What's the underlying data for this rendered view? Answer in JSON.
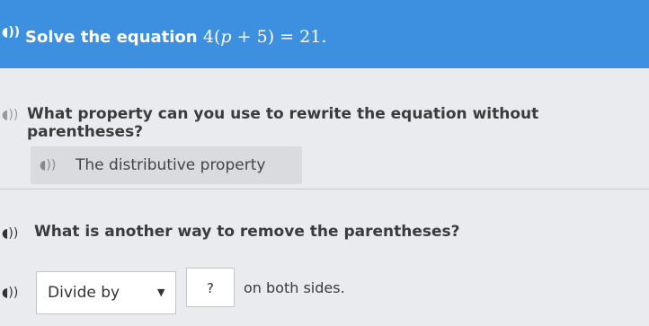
{
  "banner": {
    "prompt": "Solve the equation",
    "equation": {
      "coef": "4",
      "var": "p",
      "plus": "+",
      "const": "5",
      "rhs": "21",
      "end": "."
    }
  },
  "q1": {
    "text": "What property can you use to rewrite the equation without parentheses?"
  },
  "answer1": {
    "text": "The distributive property"
  },
  "q2": {
    "text": "What is another way to remove the parentheses?"
  },
  "row": {
    "dropdown_value": "Divide by",
    "blank_value": "?",
    "suffix": "on both sides."
  },
  "icons": {
    "audio": "speaker-icon",
    "caret": "chevron-down-icon"
  },
  "colors": {
    "banner": "#3d8fdf",
    "background": "#e9ebee",
    "chip": "#d9dbdf"
  }
}
